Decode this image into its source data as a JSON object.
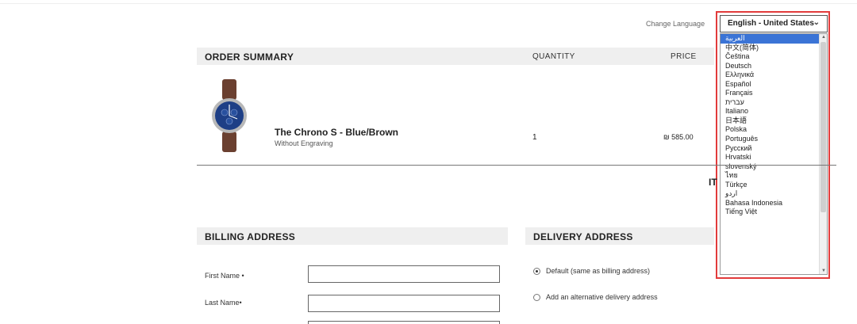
{
  "language": {
    "label": "Change Language",
    "selected": "English - United States",
    "options": [
      "العربية",
      "中文(简体)",
      "Čeština",
      "Deutsch",
      "Ελληνικά",
      "Español",
      "Français",
      "עברית",
      "Italiano",
      "日本語",
      "Polska",
      "Português",
      "Русский",
      "Hrvatski",
      "slovenský",
      "ไทย",
      "Türkçe",
      "اردو",
      "Bahasa Indonesia",
      "Tiếng Việt"
    ],
    "highlighted_index": 0
  },
  "order_summary": {
    "title": "ORDER SUMMARY",
    "quantity_header": "QUANTITY",
    "price_header": "PRICE",
    "item": {
      "name": "The Chrono S - Blue/Brown",
      "variant": "Without Engraving",
      "quantity": "1",
      "price": "₪ 585.00"
    },
    "partial_header": "IT"
  },
  "billing": {
    "title": "BILLING ADDRESS",
    "first_name_label": "First Name •",
    "last_name_label": "Last Name•",
    "first_name_value": "",
    "last_name_value": ""
  },
  "delivery": {
    "title": "DELIVERY ADDRESS",
    "option_default": "Default (same as billing address)",
    "option_alt": "Add an alternative delivery address"
  },
  "colors": {
    "highlight": "#e23b3b",
    "selected_option": "#3b74d6",
    "header_bg": "#efefef"
  }
}
